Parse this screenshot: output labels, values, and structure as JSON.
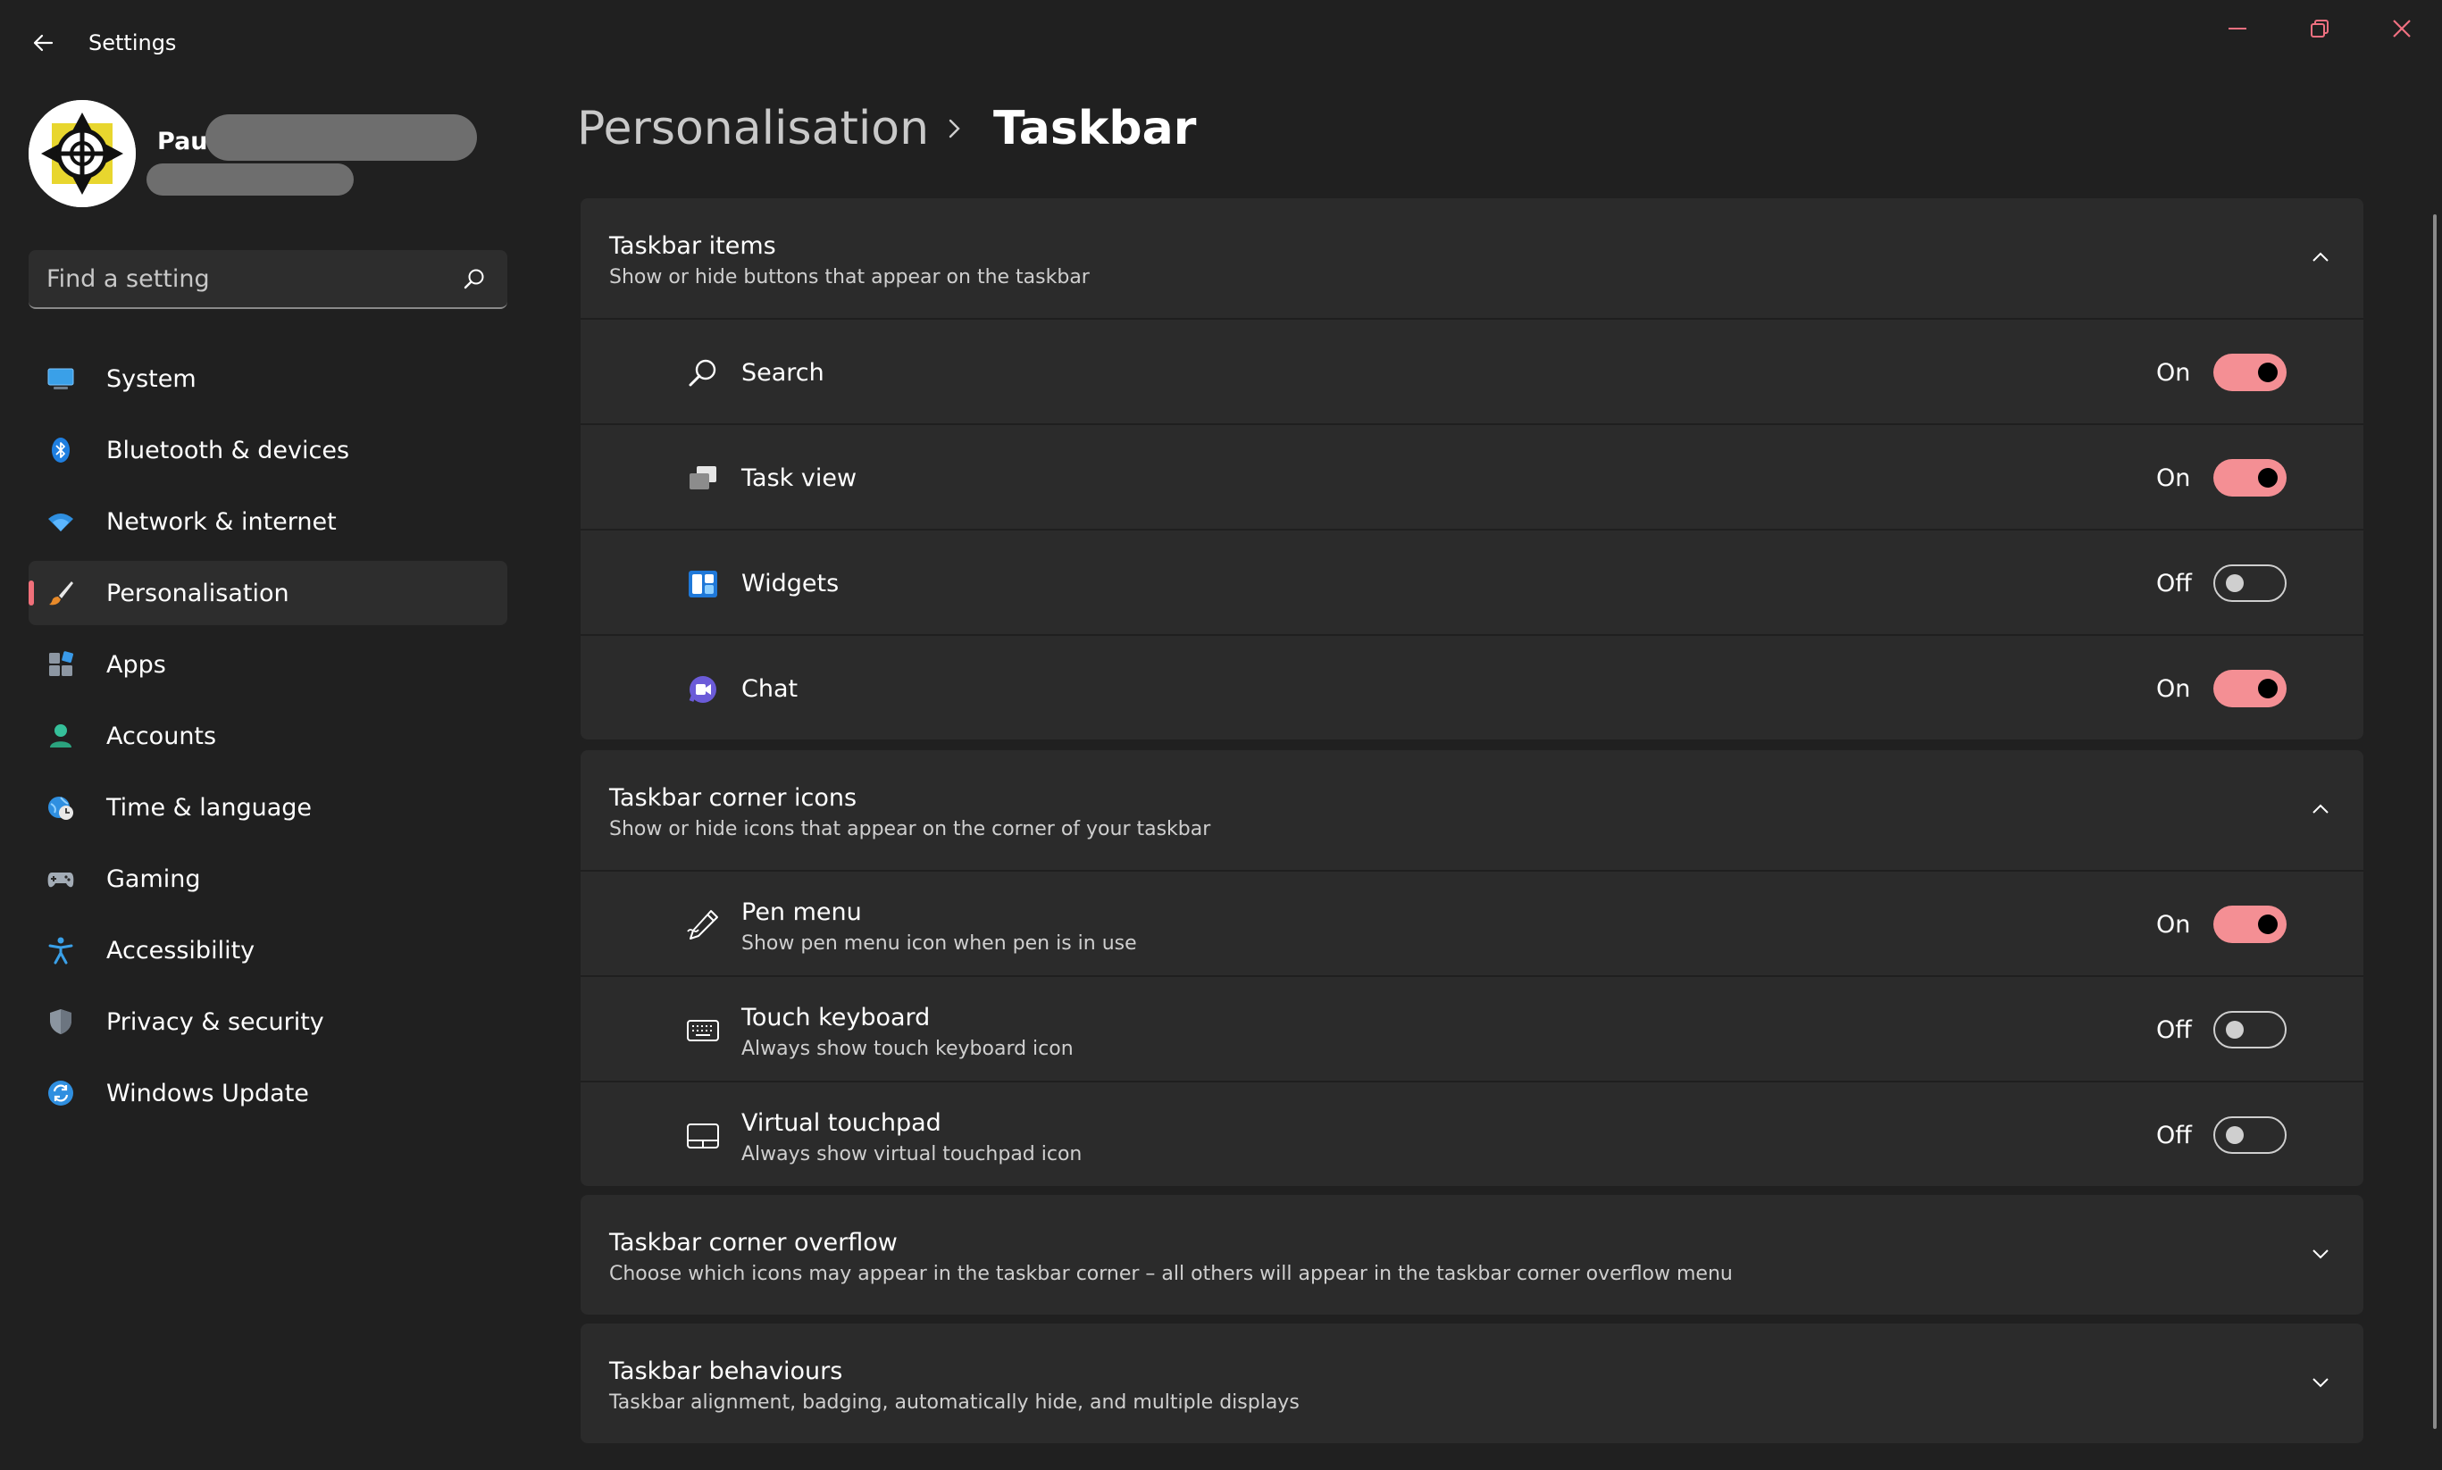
{
  "window": {
    "title": "Settings"
  },
  "profile": {
    "name": "Paul"
  },
  "search": {
    "placeholder": "Find a setting"
  },
  "sidebar": {
    "items": [
      {
        "label": "System",
        "icon": "system-icon",
        "active": false
      },
      {
        "label": "Bluetooth & devices",
        "icon": "bluetooth-icon",
        "active": false
      },
      {
        "label": "Network & internet",
        "icon": "wifi-icon",
        "active": false
      },
      {
        "label": "Personalisation",
        "icon": "brush-icon",
        "active": true
      },
      {
        "label": "Apps",
        "icon": "apps-icon",
        "active": false
      },
      {
        "label": "Accounts",
        "icon": "account-icon",
        "active": false
      },
      {
        "label": "Time & language",
        "icon": "globe-clock-icon",
        "active": false
      },
      {
        "label": "Gaming",
        "icon": "gamepad-icon",
        "active": false
      },
      {
        "label": "Accessibility",
        "icon": "accessibility-icon",
        "active": false
      },
      {
        "label": "Privacy & security",
        "icon": "shield-icon",
        "active": false
      },
      {
        "label": "Windows Update",
        "icon": "update-icon",
        "active": false
      }
    ]
  },
  "breadcrumb": {
    "parent": "Personalisation",
    "current": "Taskbar"
  },
  "sections": {
    "taskbar_items": {
      "title": "Taskbar items",
      "subtitle": "Show or hide buttons that appear on the taskbar",
      "expanded": true,
      "rows": [
        {
          "label": "Search",
          "state": "On",
          "on": true,
          "icon": "search-icon"
        },
        {
          "label": "Task view",
          "state": "On",
          "on": true,
          "icon": "task-view-icon"
        },
        {
          "label": "Widgets",
          "state": "Off",
          "on": false,
          "icon": "widgets-icon"
        },
        {
          "label": "Chat",
          "state": "On",
          "on": true,
          "icon": "chat-icon"
        }
      ]
    },
    "corner_icons": {
      "title": "Taskbar corner icons",
      "subtitle": "Show or hide icons that appear on the corner of your taskbar",
      "expanded": true,
      "rows": [
        {
          "label": "Pen menu",
          "sub": "Show pen menu icon when pen is in use",
          "state": "On",
          "on": true,
          "icon": "pen-icon"
        },
        {
          "label": "Touch keyboard",
          "sub": "Always show touch keyboard icon",
          "state": "Off",
          "on": false,
          "icon": "keyboard-icon"
        },
        {
          "label": "Virtual touchpad",
          "sub": "Always show virtual touchpad icon",
          "state": "Off",
          "on": false,
          "icon": "touchpad-icon"
        }
      ]
    },
    "corner_overflow": {
      "title": "Taskbar corner overflow",
      "subtitle": "Choose which icons may appear in the taskbar corner – all others will appear in the taskbar corner overflow menu",
      "expanded": false
    },
    "behaviours": {
      "title": "Taskbar behaviours",
      "subtitle": "Taskbar alignment, badging, automatically hide, and multiple displays",
      "expanded": false
    }
  },
  "colors": {
    "accent": "#f48f94",
    "background": "#202020",
    "card": "#2b2b2b"
  }
}
